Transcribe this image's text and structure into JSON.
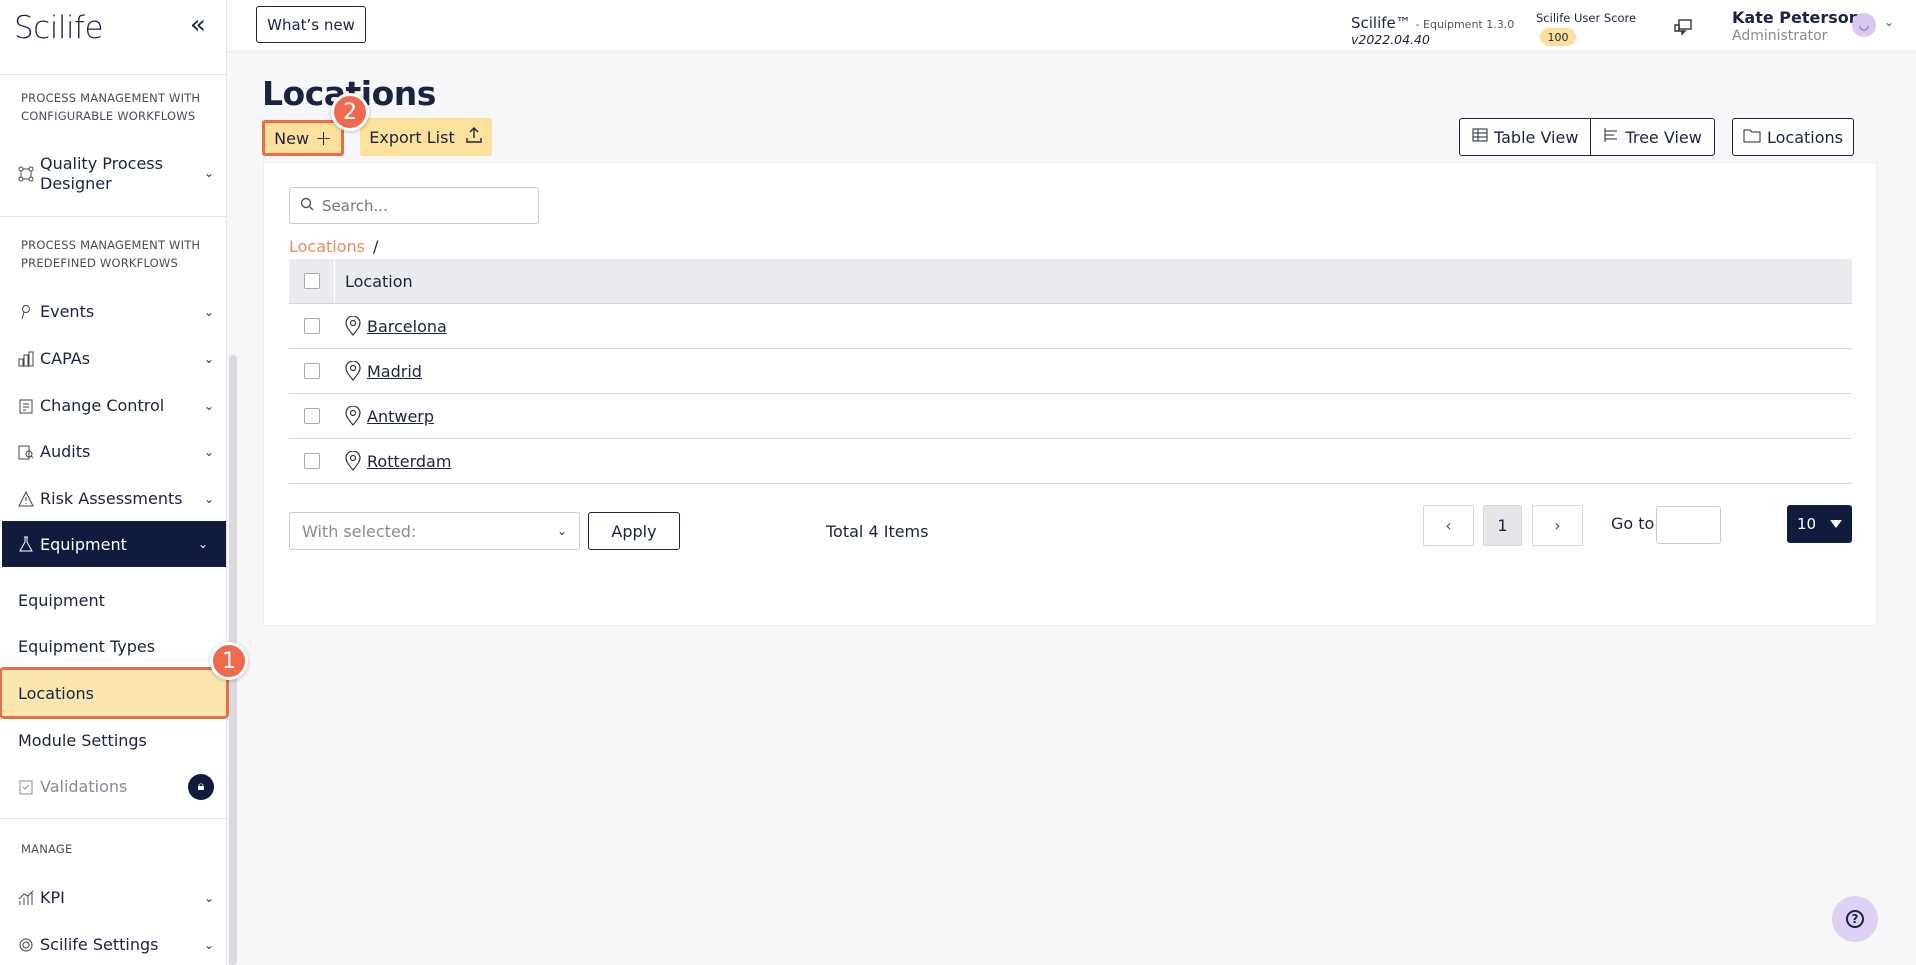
{
  "app": {
    "logo": "Scilife",
    "whats_new": "What’s new",
    "product": "Scilife™",
    "module_version": "- Equipment 1.3.0",
    "build": "v2022.04.40",
    "score_label": "Scilife User Score",
    "score_value": "100"
  },
  "user": {
    "name": "Kate Peterson",
    "role": "Administrator"
  },
  "sidebar": {
    "section_configurable": [
      "PROCESS MANAGEMENT WITH",
      "CONFIGURABLE WORKFLOWS"
    ],
    "quality_designer": [
      "Quality Process",
      "Designer"
    ],
    "section_predefined": [
      "PROCESS MANAGEMENT WITH",
      "PREDEFINED WORKFLOWS"
    ],
    "items": [
      {
        "label": "Events"
      },
      {
        "label": "CAPAs"
      },
      {
        "label": "Change Control"
      },
      {
        "label": "Audits"
      },
      {
        "label": "Risk Assessments"
      },
      {
        "label": "Equipment"
      }
    ],
    "subitems": [
      {
        "label": "Equipment"
      },
      {
        "label": "Equipment Types"
      },
      {
        "label": "Locations"
      },
      {
        "label": "Module Settings"
      }
    ],
    "validations": "Validations",
    "section_manage": "MANAGE",
    "kpi": "KPI",
    "settings": "Scilife Settings"
  },
  "steps": {
    "one": "1",
    "two": "2"
  },
  "page": {
    "title": "Locations",
    "new_label": "New",
    "export_label": "Export List",
    "table_view": "Table View",
    "tree_view": "Tree View",
    "locations_button": "Locations",
    "search_placeholder": "Search...",
    "breadcrumb_root": "Locations",
    "breadcrumb_sep": "/"
  },
  "table": {
    "column": "Location",
    "rows": [
      {
        "name": "Barcelona"
      },
      {
        "name": "Madrid"
      },
      {
        "name": "Antwerp"
      },
      {
        "name": "Rotterdam"
      }
    ]
  },
  "footer": {
    "with_selected": "With selected:",
    "apply": "Apply",
    "total": "Total 4 Items",
    "current_page": "1",
    "goto": "Go to",
    "per_page": "10"
  },
  "colors": {
    "navy": "#111b3d",
    "highlight": "#fbe19c",
    "annotation": "#ef6a4c",
    "breadcrumb_link": "#ef8a5c"
  }
}
